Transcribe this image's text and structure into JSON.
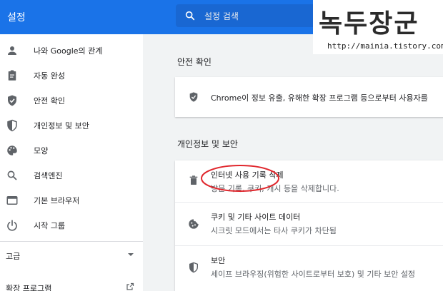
{
  "header": {
    "title": "설정",
    "search_placeholder": "설정 검색",
    "accent": "#1a73e8"
  },
  "watermark": {
    "title": "녹두장군",
    "url": "http://mainia.tistory.com"
  },
  "sidebar": {
    "items": [
      {
        "label": "나와 Google의 관계",
        "icon": "person-icon"
      },
      {
        "label": "자동 완성",
        "icon": "clipboard-icon"
      },
      {
        "label": "안전 확인",
        "icon": "shield-check-icon"
      },
      {
        "label": "개인정보 및 보안",
        "icon": "shield-half-icon"
      },
      {
        "label": "모양",
        "icon": "palette-icon"
      },
      {
        "label": "검색엔진",
        "icon": "search-icon"
      },
      {
        "label": "기본 브라우저",
        "icon": "browser-icon"
      },
      {
        "label": "시작 그룹",
        "icon": "power-icon"
      }
    ],
    "advanced": "고급",
    "extensions": "확장 프로그램"
  },
  "main": {
    "safety_title": "안전 확인",
    "safety_text": "Chrome이 정보 유출, 유해한 확장 프로그램 등으로부터 사용자를",
    "privacy_title": "개인정보 및 보안",
    "privacy_rows": [
      {
        "title": "인터넷 사용 기록 삭제",
        "sub": "방문 기록, 쿠키, 캐시 등을 삭제합니다.",
        "icon": "trash-icon"
      },
      {
        "title": "쿠키 및 기타 사이트 데이터",
        "sub": "시크릿 모드에서는 타사 쿠키가 차단됨",
        "icon": "cookie-icon"
      },
      {
        "title": "보안",
        "sub": "세이프 브라우징(위험한 사이트로부터 보호) 및 기타 보안 설정",
        "icon": "shield-half-icon"
      }
    ]
  }
}
